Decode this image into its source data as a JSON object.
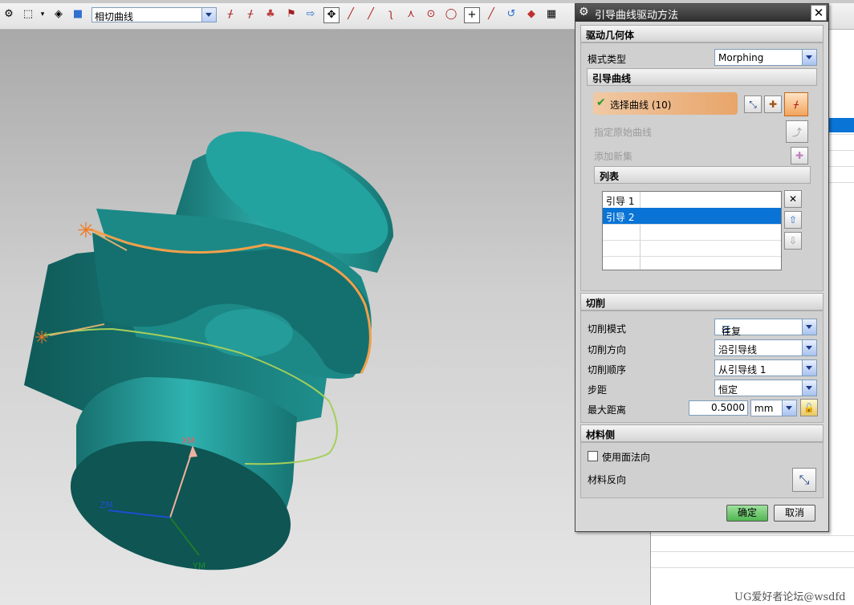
{
  "toolbar": {
    "curve_combo_value": "相切曲线",
    "icons": [
      "selection-filter-icon",
      "box-select-icon",
      "dropdown-icon",
      "solid-view-icon",
      "cube-icon",
      "snap-endpoint-icon",
      "snap-midpoint-icon",
      "snap-control-icon",
      "snap-intersection-icon",
      "arrow-right-icon",
      "point-snap-icon",
      "line-icon",
      "line2-icon",
      "curve-icon",
      "arc-icon",
      "circle-center-icon",
      "circle-icon",
      "plus-icon",
      "diagonal-icon",
      "rotate-icon",
      "render-icon",
      "grid-icon"
    ]
  },
  "viewport": {
    "axis_x": "XM",
    "axis_y": "YM",
    "axis_z": "ZM",
    "colors": {
      "part": "#1f8f8d",
      "guide1": "#f0a04b",
      "guide2": "#a4cf5b"
    }
  },
  "dialog": {
    "title": "引导曲线驱动方法",
    "drive_geometry": {
      "header": "驱动几何体",
      "mode_type_label": "模式类型",
      "mode_type_value": "Morphing",
      "guide_curves": {
        "header": "引导曲线",
        "select_curve": "选择曲线 (10)",
        "specify_original_curve": "指定原始曲线",
        "add_new_set": "添加新集",
        "list": {
          "header": "列表",
          "items": [
            "引导 1",
            "引导 2"
          ],
          "selected_index": 1
        }
      }
    },
    "cutting": {
      "header": "切削",
      "cut_mode_label": "切削模式",
      "cut_mode_value": "往复",
      "cut_direction_label": "切削方向",
      "cut_direction_value": "沿引导线",
      "cut_order_label": "切削顺序",
      "cut_order_value": "从引导线 1",
      "stepover_label": "步距",
      "stepover_value": "恒定",
      "max_distance_label": "最大距离",
      "max_distance_value": "0.5000",
      "max_distance_unit": "mm"
    },
    "material_side": {
      "header": "材料侧",
      "use_face_normal_label": "使用面法向",
      "use_face_normal_checked": false,
      "reverse_material_label": "材料反向"
    },
    "ok_label": "确定",
    "cancel_label": "取消"
  },
  "watermark": "UG爱好者论坛@wsdfd"
}
